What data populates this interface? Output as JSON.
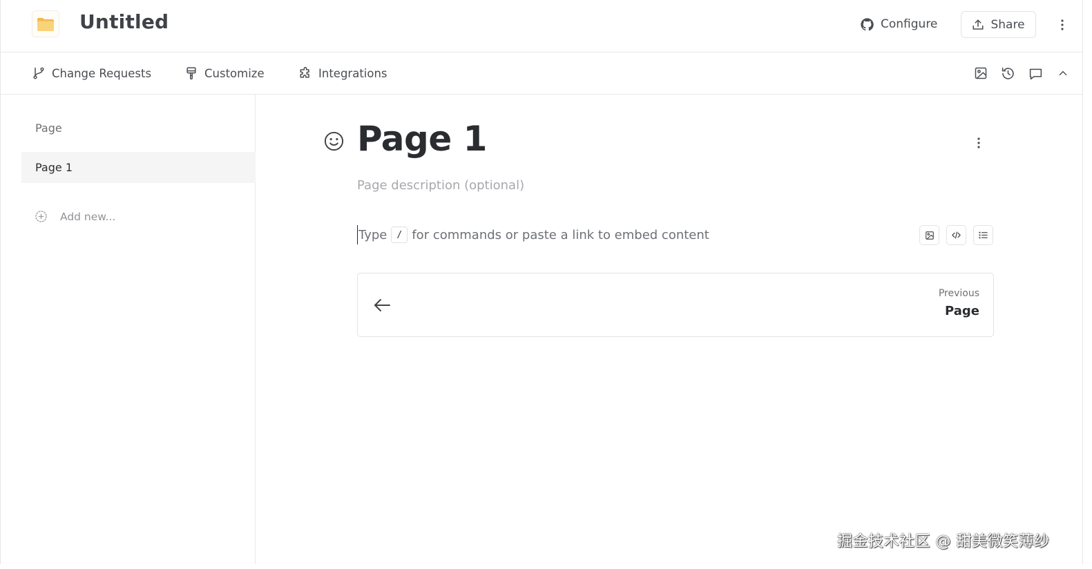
{
  "header": {
    "title": "Untitled",
    "configure_label": "Configure",
    "share_label": "Share",
    "logo_icon": "folder-icon",
    "colors": {
      "folder": "#f8cf6f",
      "folder_back": "#f2b84b"
    }
  },
  "toolbar": {
    "tabs": [
      {
        "label": "Change Requests",
        "icon": "git-branch-icon"
      },
      {
        "label": "Customize",
        "icon": "paint-brush-icon"
      },
      {
        "label": "Integrations",
        "icon": "puzzle-icon"
      }
    ],
    "right_icons": [
      "image-icon",
      "history-icon",
      "comment-icon",
      "chevron-up-icon"
    ]
  },
  "sidebar": {
    "section_label": "Page",
    "items": [
      {
        "label": "Page 1"
      }
    ],
    "add_label": "Add new..."
  },
  "main": {
    "page_title": "Page 1",
    "description_placeholder": "Page description (optional)",
    "editor": {
      "prefix": "Type",
      "key": "/",
      "suffix": "for commands or paste a link to embed content"
    },
    "nav": {
      "previous_label": "Previous",
      "previous_title": "Page"
    }
  },
  "watermark": "掘金技术社区 @ 甜美微笑薄纱"
}
